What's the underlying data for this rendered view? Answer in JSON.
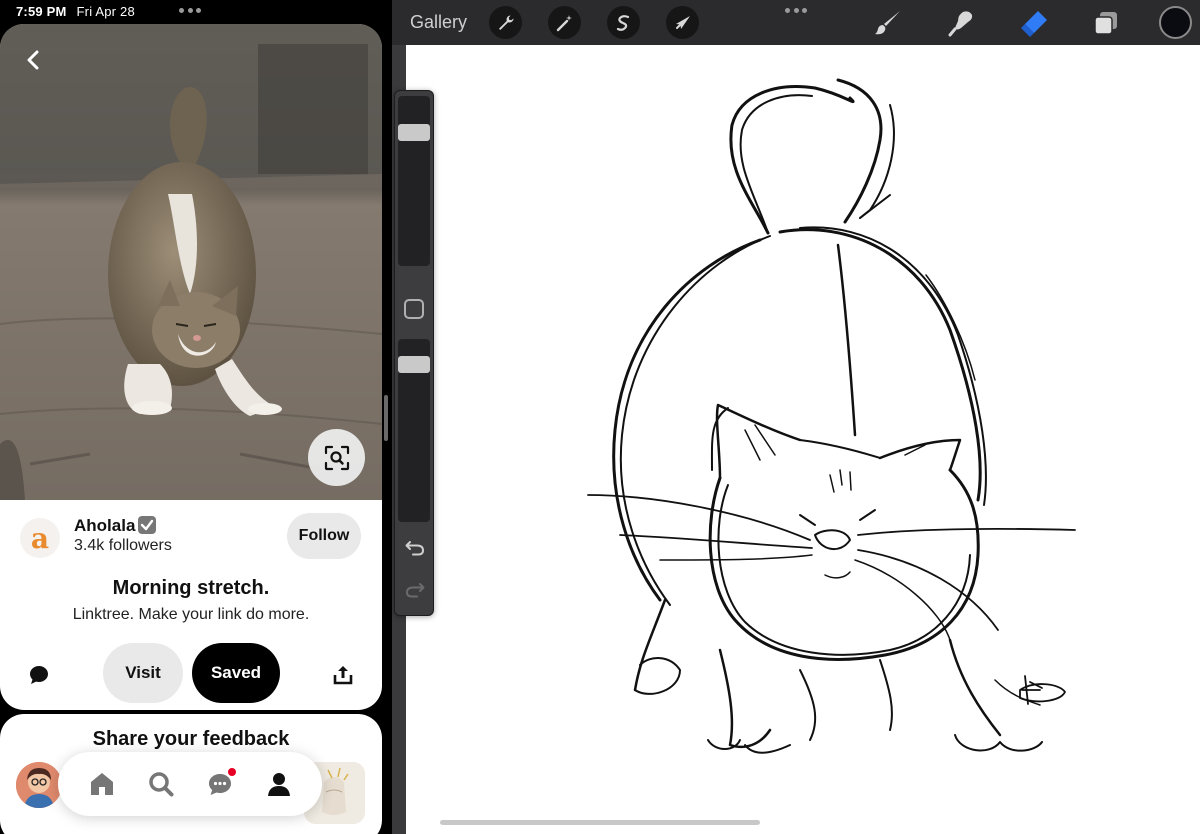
{
  "status_bar": {
    "time": "7:59 PM",
    "date": "Fri Apr 28"
  },
  "pin": {
    "creator_name": "Aholala",
    "creator_followers": "3.4k followers",
    "creator_avatar_letter": "a",
    "follow_label": "Follow",
    "title": "Morning stretch.",
    "description": "Linktree. Make your link do more.",
    "visit_label": "Visit",
    "saved_label": "Saved"
  },
  "feedback": {
    "title": "Share your feedback"
  },
  "tabbar": {
    "items": [
      {
        "name": "home",
        "icon": "home-icon"
      },
      {
        "name": "search",
        "icon": "search-icon"
      },
      {
        "name": "messages",
        "icon": "chat-bubble-icon",
        "has_notification": true
      },
      {
        "name": "profile",
        "icon": "person-icon"
      }
    ],
    "notification_color": "#e60023"
  },
  "procreate": {
    "gallery_label": "Gallery",
    "tools_left": [
      "wrench-icon",
      "magic-wand-icon",
      "selection-s-icon",
      "arrow-cursor-icon"
    ],
    "tools_right": [
      "brush-icon",
      "smudge-icon",
      "eraser-icon",
      "layers-icon"
    ],
    "active_tool": "eraser",
    "active_tool_color": "#2f7cf6",
    "current_color": "#0b0b12",
    "brush_size_level": 0.82,
    "opacity_level": 0.9
  }
}
